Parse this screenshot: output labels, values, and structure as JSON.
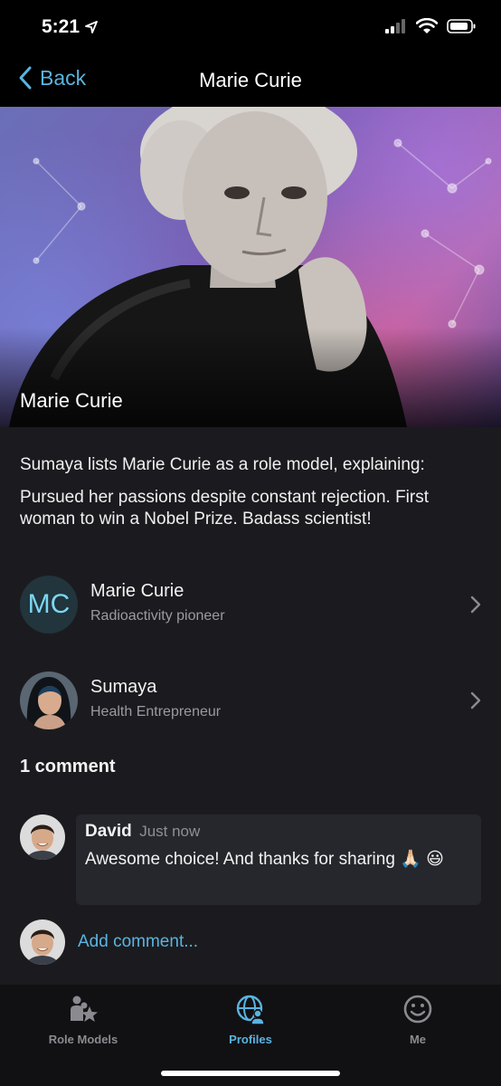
{
  "status": {
    "time": "5:21"
  },
  "nav": {
    "back_label": "Back",
    "title": "Marie Curie"
  },
  "hero": {
    "caption": "Marie Curie"
  },
  "description": {
    "intro": "Sumaya lists Marie Curie as a role model, explaining:",
    "quote": "Pursued her passions despite constant rejection. First woman to win a Nobel Prize. Badass scientist!"
  },
  "profiles": [
    {
      "initials": "MC",
      "name": "Marie Curie",
      "subtitle": "Radioactivity pioneer"
    },
    {
      "name": "Sumaya",
      "subtitle": "Health Entrepreneur"
    }
  ],
  "comments": {
    "count_label": "1 comment",
    "items": [
      {
        "author": "David",
        "time": "Just now",
        "text": "Awesome choice! And thanks for sharing 🙏🏻 😃"
      }
    ],
    "add_placeholder": "Add comment..."
  },
  "tabs": [
    {
      "label": "Role Models",
      "icon": "role-models-icon"
    },
    {
      "label": "Profiles",
      "icon": "globe-person-icon",
      "active": true
    },
    {
      "label": "Me",
      "icon": "smiley-icon"
    }
  ],
  "colors": {
    "accent": "#5ab4e0",
    "background": "#1b1b1f",
    "tab_bar": "#111114"
  }
}
